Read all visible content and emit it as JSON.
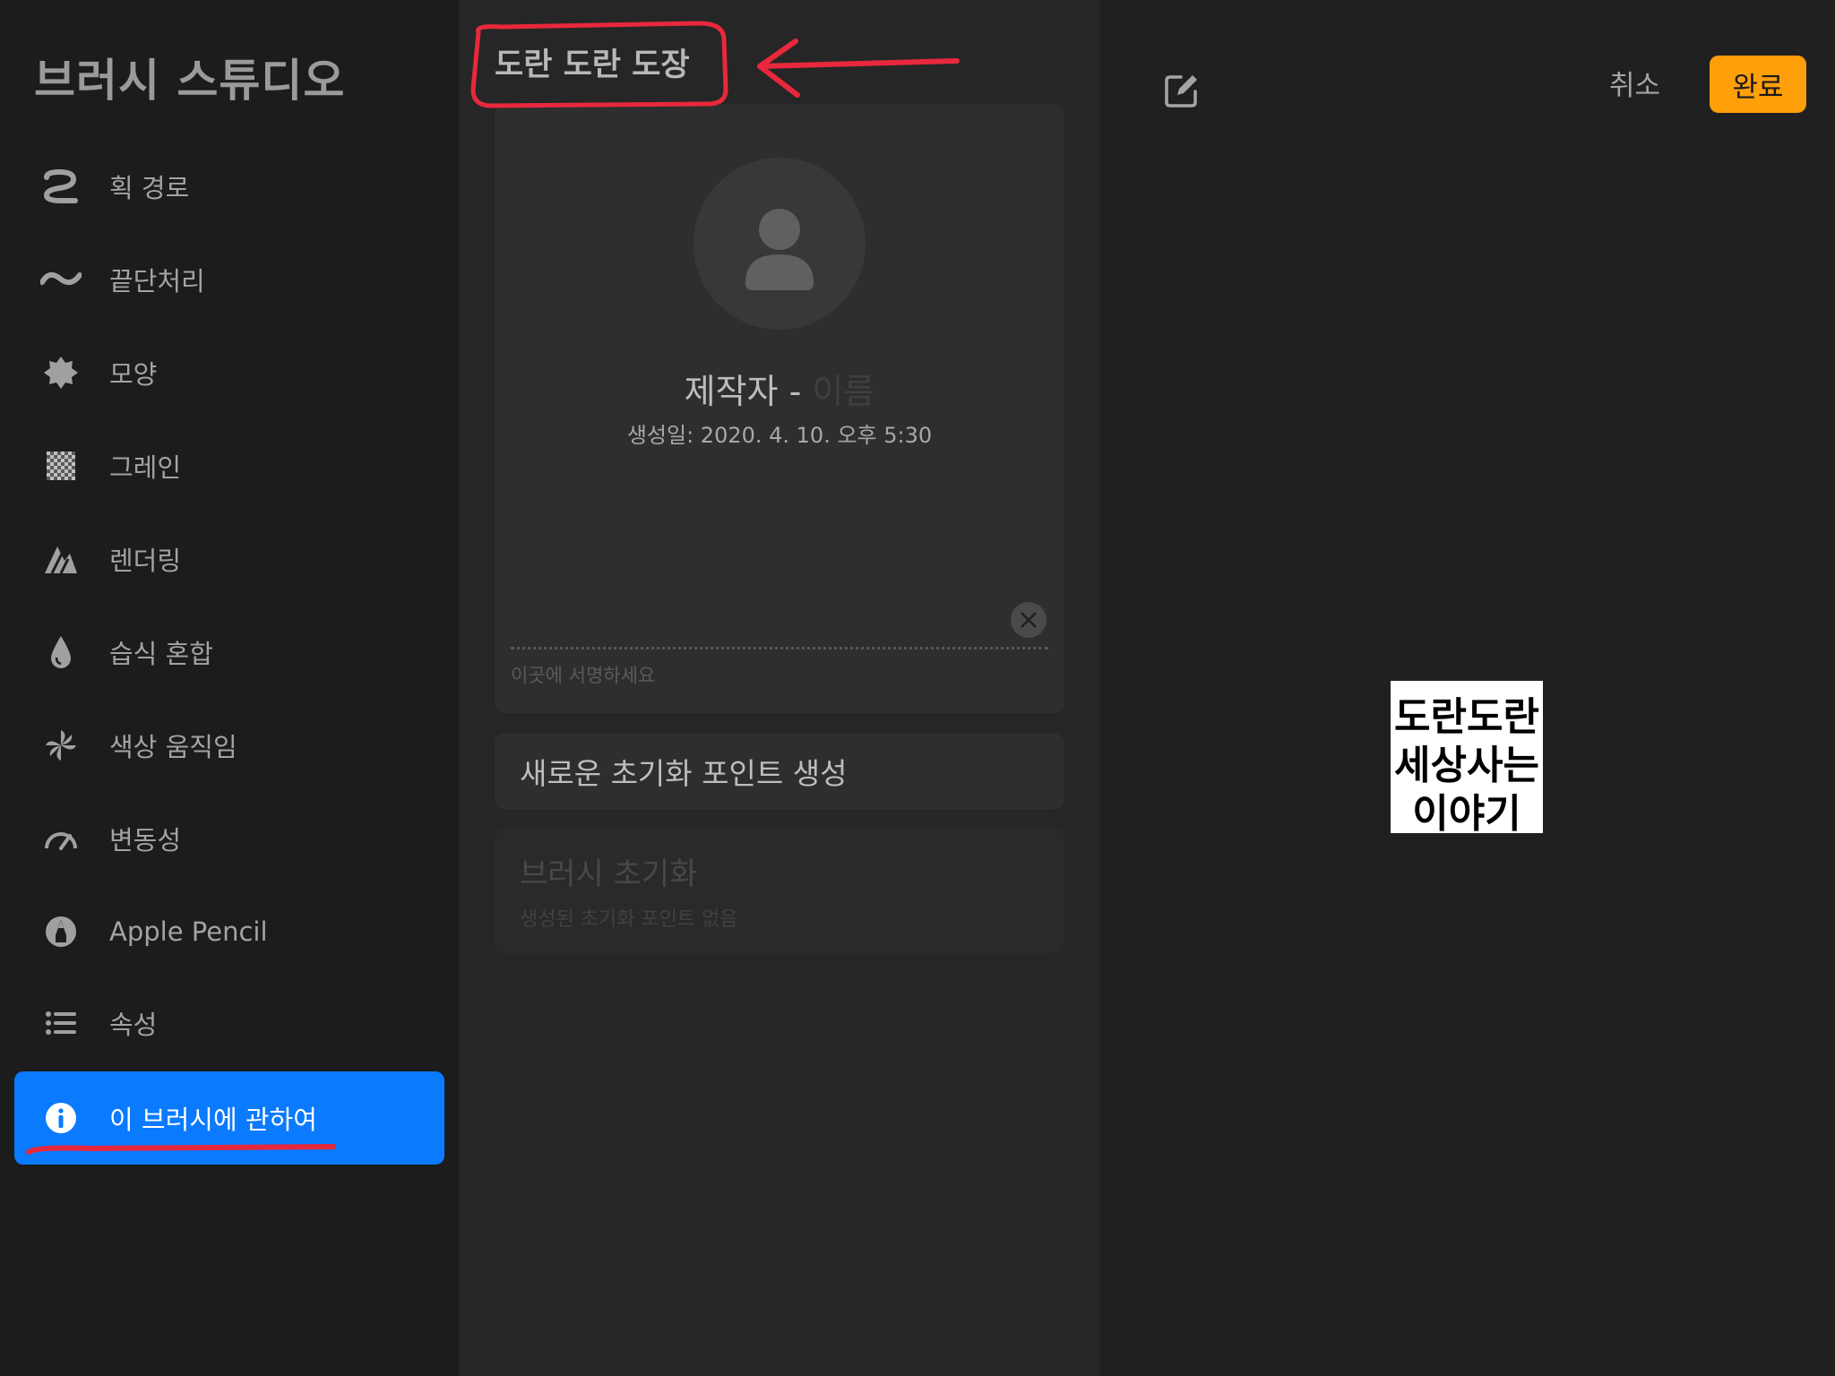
{
  "sidebar": {
    "title": "브러시 스튜디오",
    "items": [
      {
        "label": "획 경로",
        "icon": "stroke-path-icon"
      },
      {
        "label": "끝단처리",
        "icon": "taper-icon"
      },
      {
        "label": "모양",
        "icon": "shape-icon"
      },
      {
        "label": "그레인",
        "icon": "grain-icon"
      },
      {
        "label": "렌더링",
        "icon": "rendering-icon"
      },
      {
        "label": "습식 혼합",
        "icon": "wet-mix-icon"
      },
      {
        "label": "색상 움직임",
        "icon": "color-dynamics-icon"
      },
      {
        "label": "변동성",
        "icon": "dynamics-icon"
      },
      {
        "label": "Apple Pencil",
        "icon": "apple-pencil-icon"
      },
      {
        "label": "속성",
        "icon": "properties-icon"
      },
      {
        "label": "이 브러시에 관하여",
        "icon": "info-icon",
        "active": true
      }
    ]
  },
  "about": {
    "brush_name": "도란 도란 도장",
    "creator_label": "제작자 - ",
    "creator_placeholder": "이름",
    "created": "생성일: 2020. 4. 10. 오후 5:30",
    "signature_hint": "이곳에 서명하세요",
    "new_reset_point": "새로운 초기화 포인트 생성",
    "brush_reset_title": "브러시 초기화",
    "brush_reset_sub": "생성된 초기화 포인트 없음"
  },
  "toolbar": {
    "cancel": "취소",
    "done": "완료"
  },
  "preview": {
    "lines": [
      "도란도란",
      "세상사는",
      "이야기"
    ]
  },
  "colors": {
    "accent_blue": "#0a7aff",
    "done_orange": "#ff9f0a",
    "annotation_red": "#e8283c"
  }
}
